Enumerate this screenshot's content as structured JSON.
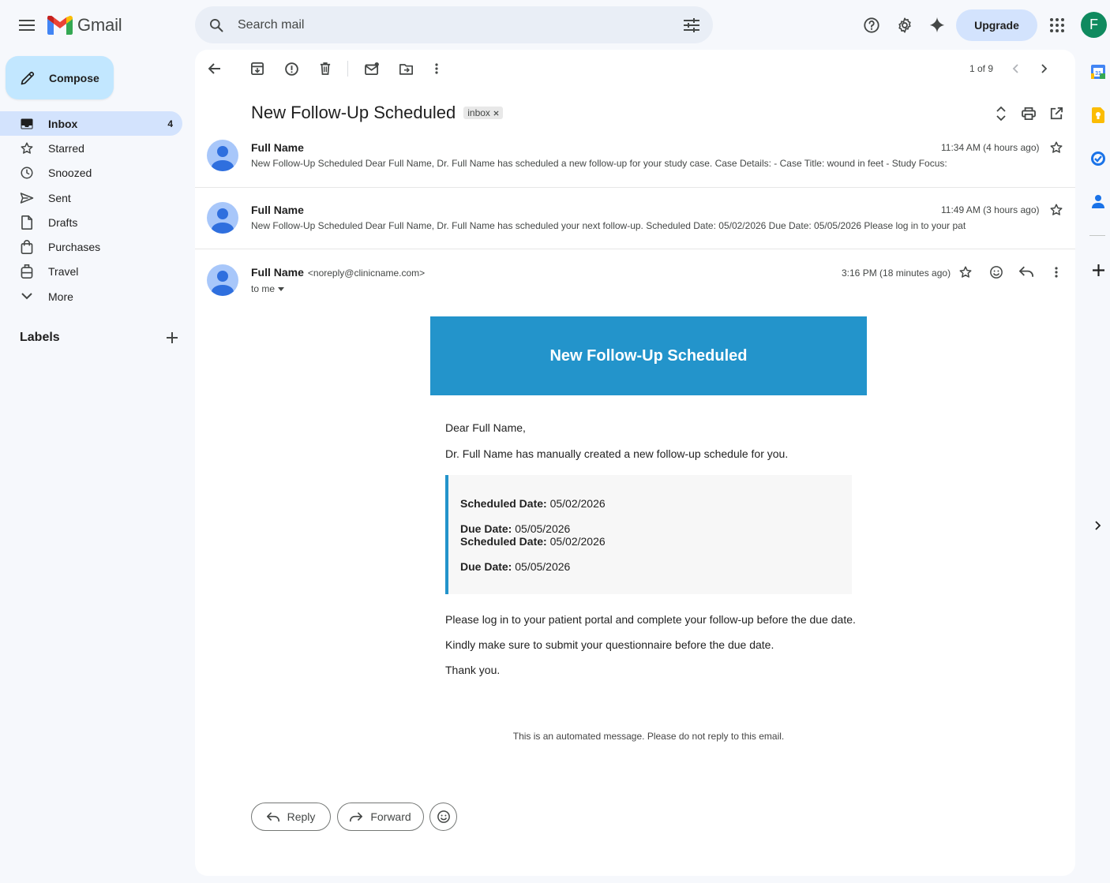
{
  "app": {
    "logo_text": "Gmail"
  },
  "search": {
    "placeholder": "Search mail"
  },
  "header": {
    "upgrade_label": "Upgrade",
    "account_initial": "F"
  },
  "compose": {
    "label": "Compose"
  },
  "nav": {
    "items": [
      {
        "label": "Inbox",
        "count": "4",
        "icon": "inbox-icon"
      },
      {
        "label": "Starred",
        "count": "",
        "icon": "star-icon"
      },
      {
        "label": "Snoozed",
        "count": "",
        "icon": "clock-icon"
      },
      {
        "label": "Sent",
        "count": "",
        "icon": "send-icon"
      },
      {
        "label": "Drafts",
        "count": "",
        "icon": "draft-icon"
      },
      {
        "label": "Purchases",
        "count": "",
        "icon": "bag-icon"
      },
      {
        "label": "Travel",
        "count": "",
        "icon": "luggage-icon"
      },
      {
        "label": "More",
        "count": "",
        "icon": "chevron-down-icon"
      }
    ],
    "labels_heading": "Labels"
  },
  "toolbar": {
    "pager": "1 of 9"
  },
  "thread": {
    "subject": "New Follow-Up Scheduled",
    "chip": "inbox",
    "messages": [
      {
        "sender": "Full Name",
        "time": "11:34 AM (4 hours ago)",
        "snippet": "New Follow-Up Scheduled Dear Full Name, Dr. Full Name has scheduled a new follow-up for your study case. Case Details: - Case Title: wound in feet - Study Focus:"
      },
      {
        "sender": "Full Name",
        "time": "11:49 AM (3 hours ago)",
        "snippet": "New Follow-Up Scheduled Dear Full Name, Dr. Full Name has scheduled your next follow-up. Scheduled Date: 05/02/2026 Due Date: 05/05/2026 Please log in to your pat"
      }
    ],
    "open": {
      "sender": "Full Name",
      "email": "<noreply@clinicname.com>",
      "time": "3:16 PM (18 minutes ago)",
      "to": "to me"
    }
  },
  "email": {
    "banner": "New Follow-Up Scheduled",
    "greeting": "Dear Full Name,",
    "intro": "Dr. Full Name has manually created a new follow-up schedule for you.",
    "details": {
      "scheduled_label": "Scheduled Date:",
      "scheduled_value": "05/02/2026",
      "due_label": "Due Date:",
      "due_value": "05/05/2026"
    },
    "p1": "Please log in to your patient portal and complete your follow-up before the due date.",
    "p2": "Kindly make sure to submit your questionnaire before the due date.",
    "p3": "Thank you.",
    "footer": "This is an automated message. Please do not reply to this email."
  },
  "actions": {
    "reply_label": "Reply",
    "forward_label": "Forward"
  },
  "colors": {
    "accent": "#2394cb",
    "compose_bg": "#c2e7ff",
    "active_nav": "#d3e3fd",
    "avatar": "#0f8a5f"
  }
}
